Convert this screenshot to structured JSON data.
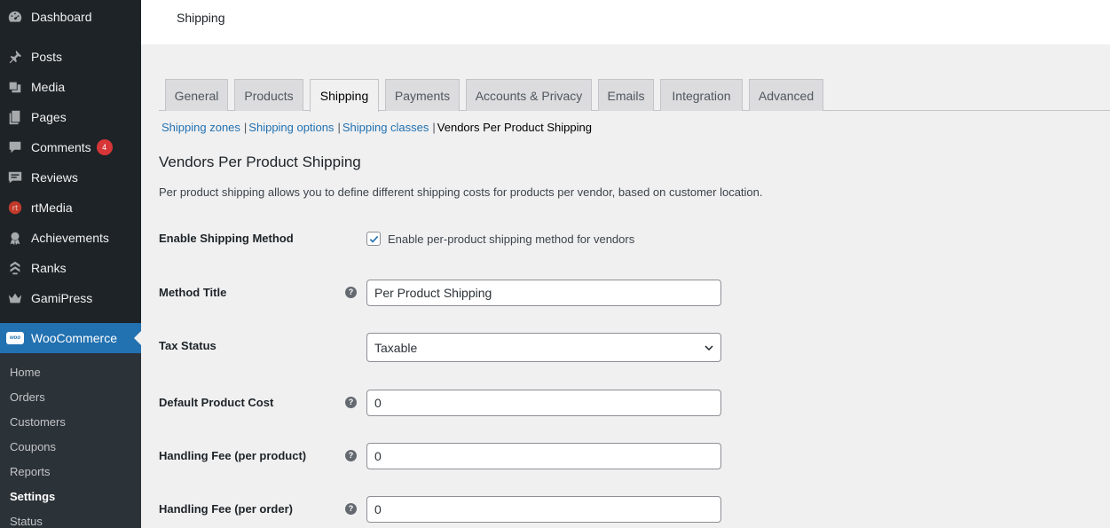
{
  "sidebar": {
    "items": [
      {
        "label": "Dashboard",
        "icon": "dashboard-icon"
      },
      {
        "label": "Posts",
        "icon": "pin-icon"
      },
      {
        "label": "Media",
        "icon": "media-icon"
      },
      {
        "label": "Pages",
        "icon": "pages-icon"
      },
      {
        "label": "Comments",
        "icon": "comment-icon",
        "badge": "4"
      },
      {
        "label": "Reviews",
        "icon": "reviews-icon"
      },
      {
        "label": "rtMedia",
        "icon": "rtmedia-icon"
      },
      {
        "label": "Achievements",
        "icon": "award-icon"
      },
      {
        "label": "Ranks",
        "icon": "ranks-icon"
      },
      {
        "label": "GamiPress",
        "icon": "crown-icon"
      }
    ],
    "current": {
      "label": "WooCommerce",
      "logo_text": "woo"
    },
    "submenu": [
      "Home",
      "Orders",
      "Customers",
      "Coupons",
      "Reports",
      "Settings",
      "Status"
    ],
    "submenu_active": "Settings"
  },
  "topbar": {
    "title": "Shipping"
  },
  "tabs": [
    "General",
    "Products",
    "Shipping",
    "Payments",
    "Accounts & Privacy",
    "Emails",
    "Integration",
    "Advanced"
  ],
  "active_tab": "Shipping",
  "subnav": {
    "links": [
      "Shipping zones",
      "Shipping options",
      "Shipping classes"
    ],
    "current": "Vendors Per Product Shipping"
  },
  "section": {
    "title": "Vendors Per Product Shipping",
    "description": "Per product shipping allows you to define different shipping costs for products per vendor, based on customer location."
  },
  "form": {
    "enable": {
      "label": "Enable Shipping Method",
      "checkbox_label": "Enable per-product shipping method for vendors",
      "checked": true
    },
    "method_title": {
      "label": "Method Title",
      "value": "Per Product Shipping"
    },
    "tax_status": {
      "label": "Tax Status",
      "value": "Taxable"
    },
    "default_cost": {
      "label": "Default Product Cost",
      "value": "0"
    },
    "fee_product": {
      "label": "Handling Fee (per product)",
      "value": "0"
    },
    "fee_order": {
      "label": "Handling Fee (per order)",
      "value": "0"
    }
  },
  "help_glyph": "?",
  "colors": {
    "sidebar": "#1d2327",
    "accent": "#2271b1",
    "badge": "#d63638"
  }
}
